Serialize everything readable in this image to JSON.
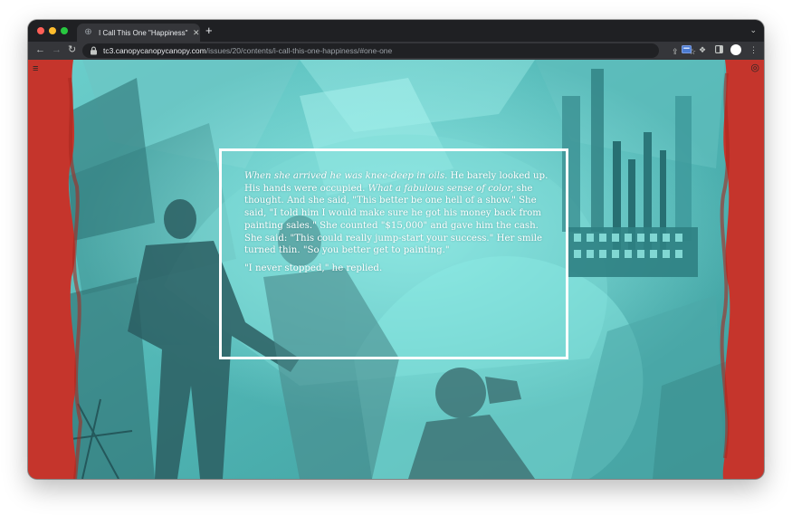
{
  "browser": {
    "tab_title": "I Call This One \"Happiness\" - T",
    "url_host": "tc3.canopycanopycanopy.com",
    "url_path": "/issues/20/contents/i-call-this-one-happiness/#one-one"
  },
  "colors": {
    "teal_background": "#58bdbc",
    "red_border": "#c5352c",
    "frame": "#ffffff"
  },
  "icons": {
    "menu": "hamburger-icon",
    "settings": "settings-icon"
  },
  "story": {
    "p1_italic_a": "When she arrived he was knee-deep in oils.",
    "p1_a": " He barely looked up. His hands were occupied. ",
    "p1_italic_b": "What a fabulous sense of color,",
    "p1_b": " she thought. And she said, \"This better be one hell of a show.\" She said, \"I told him I would make sure he got his money back from painting sales.\" She counted \"$15,000\" and gave him the cash. She said: \"This could really jump-start your success.\" Her smile turned thin. \"So you better get to painting.\"",
    "p2": "\"I never stopped,\" he replied."
  }
}
